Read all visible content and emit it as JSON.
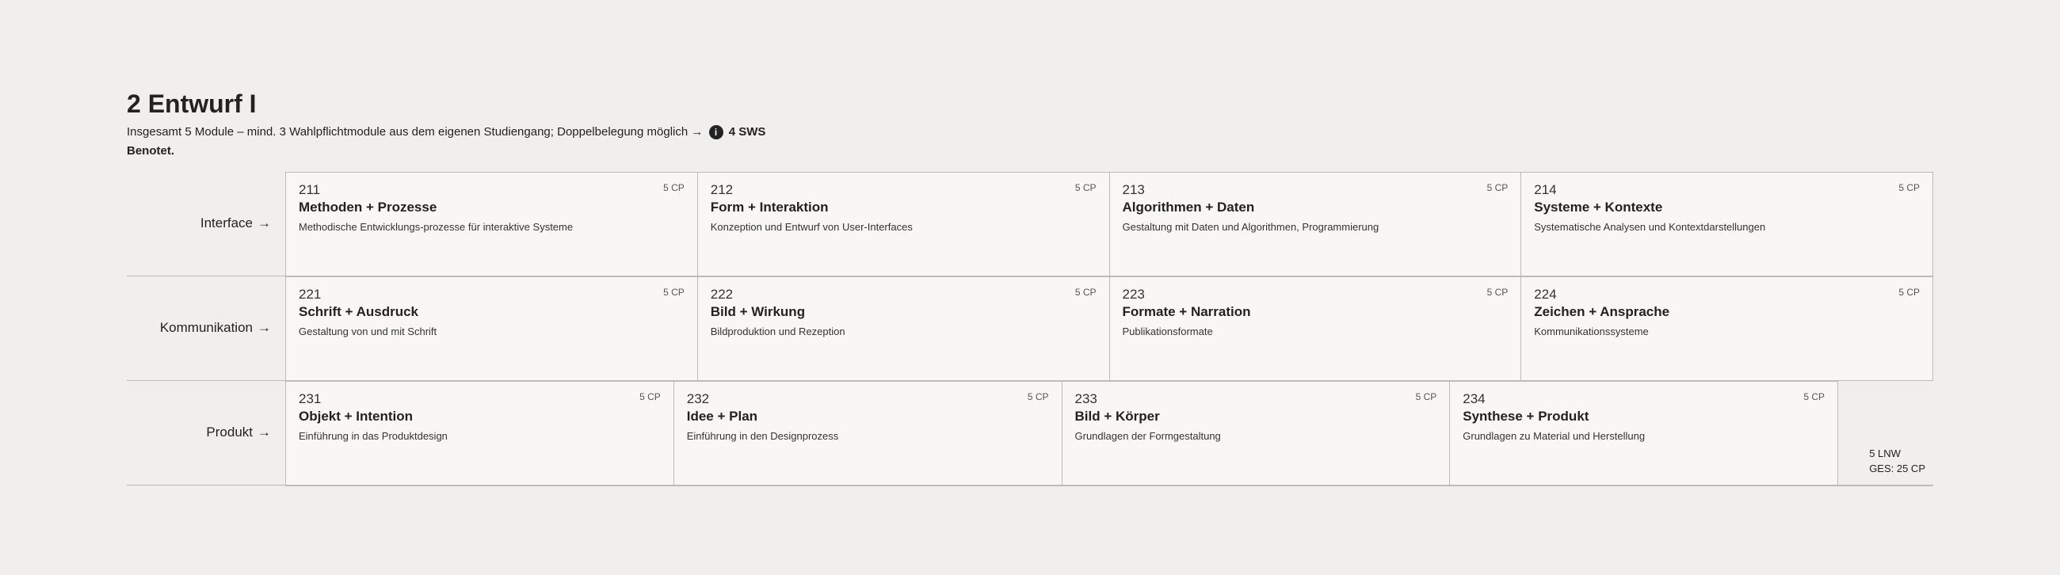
{
  "header": {
    "title": "2 Entwurf I",
    "subtitle": "Insgesamt 5 Module – mind. 3 Wahlpflichtmodule aus dem eigenen Studiengang; Doppelbelegung möglich →",
    "info_icon": "i",
    "sws": "4 SWS",
    "benotet": "Benotet."
  },
  "rows": [
    {
      "label": "Interface",
      "arrow": "→",
      "cards": [
        {
          "number": "211",
          "cp": "5 CP",
          "title": "Methoden + Prozesse",
          "desc": "Methodische Entwicklungs-prozesse für interaktive Systeme"
        },
        {
          "number": "212",
          "cp": "5 CP",
          "title": "Form + Interaktion",
          "desc": "Konzeption und Entwurf von User-Interfaces"
        },
        {
          "number": "213",
          "cp": "5 CP",
          "title": "Algorithmen + Daten",
          "desc": "Gestaltung mit Daten und Algorithmen, Programmierung"
        },
        {
          "number": "214",
          "cp": "5 CP",
          "title": "Systeme + Kontexte",
          "desc": "Systematische Analysen und Kontextdarstellungen"
        }
      ]
    },
    {
      "label": "Kommunikation",
      "arrow": "→",
      "cards": [
        {
          "number": "221",
          "cp": "5 CP",
          "title": "Schrift + Ausdruck",
          "desc": "Gestaltung von und mit Schrift"
        },
        {
          "number": "222",
          "cp": "5 CP",
          "title": "Bild + Wirkung",
          "desc": "Bildproduktion und Rezeption"
        },
        {
          "number": "223",
          "cp": "5 CP",
          "title": "Formate + Narration",
          "desc": "Publikationsformate"
        },
        {
          "number": "224",
          "cp": "5 CP",
          "title": "Zeichen + Ansprache",
          "desc": "Kommunikationssysteme"
        }
      ]
    },
    {
      "label": "Produkt",
      "arrow": "→",
      "cards": [
        {
          "number": "231",
          "cp": "5 CP",
          "title": "Objekt + Intention",
          "desc": "Einführung in das Produktdesign"
        },
        {
          "number": "232",
          "cp": "5 CP",
          "title": "Idee + Plan",
          "desc": "Einführung in den Designprozess"
        },
        {
          "number": "233",
          "cp": "5 CP",
          "title": "Bild + Körper",
          "desc": "Grundlagen der Formgestaltung"
        },
        {
          "number": "234",
          "cp": "5 CP",
          "title": "Synthese + Produkt",
          "desc": "Grundlagen zu Material und Herstellung"
        }
      ]
    }
  ],
  "footer": {
    "lnw": "5 LNW",
    "ges": "GES: 25 CP"
  }
}
